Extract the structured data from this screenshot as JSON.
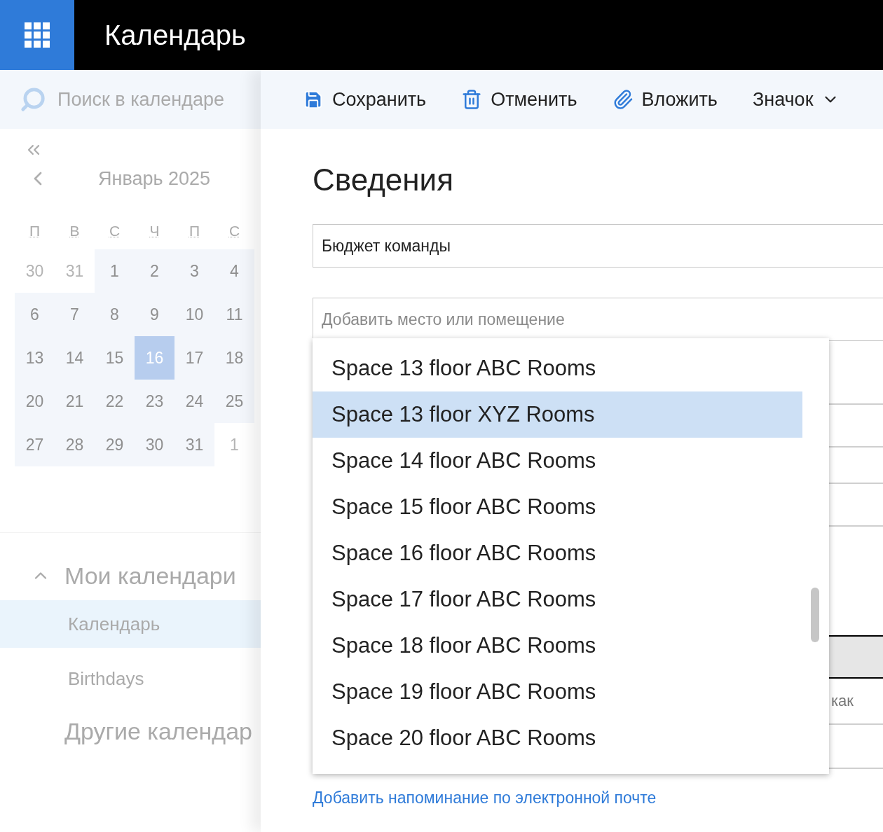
{
  "app_bar": {
    "title": "Календарь"
  },
  "search": {
    "placeholder": "Поиск в календаре"
  },
  "mini_calendar": {
    "month": "Январь 2025",
    "weekdays": [
      "П",
      "В",
      "С",
      "Ч",
      "П",
      "С"
    ],
    "weeks": [
      [
        {
          "label": "30",
          "other_month": true,
          "selected": false
        },
        {
          "label": "31",
          "other_month": true,
          "selected": false
        },
        {
          "label": "1",
          "other_month": false,
          "selected": false
        },
        {
          "label": "2",
          "other_month": false,
          "selected": false
        },
        {
          "label": "3",
          "other_month": false,
          "selected": false
        },
        {
          "label": "4",
          "other_month": false,
          "selected": false
        }
      ],
      [
        {
          "label": "6",
          "other_month": false,
          "selected": false
        },
        {
          "label": "7",
          "other_month": false,
          "selected": false
        },
        {
          "label": "8",
          "other_month": false,
          "selected": false
        },
        {
          "label": "9",
          "other_month": false,
          "selected": false
        },
        {
          "label": "10",
          "other_month": false,
          "selected": false
        },
        {
          "label": "11",
          "other_month": false,
          "selected": false
        }
      ],
      [
        {
          "label": "13",
          "other_month": false,
          "selected": false
        },
        {
          "label": "14",
          "other_month": false,
          "selected": false
        },
        {
          "label": "15",
          "other_month": false,
          "selected": false
        },
        {
          "label": "16",
          "other_month": false,
          "selected": true
        },
        {
          "label": "17",
          "other_month": false,
          "selected": false
        },
        {
          "label": "18",
          "other_month": false,
          "selected": false
        }
      ],
      [
        {
          "label": "20",
          "other_month": false,
          "selected": false
        },
        {
          "label": "21",
          "other_month": false,
          "selected": false
        },
        {
          "label": "22",
          "other_month": false,
          "selected": false
        },
        {
          "label": "23",
          "other_month": false,
          "selected": false
        },
        {
          "label": "24",
          "other_month": false,
          "selected": false
        },
        {
          "label": "25",
          "other_month": false,
          "selected": false
        }
      ],
      [
        {
          "label": "27",
          "other_month": false,
          "selected": false
        },
        {
          "label": "28",
          "other_month": false,
          "selected": false
        },
        {
          "label": "29",
          "other_month": false,
          "selected": false
        },
        {
          "label": "30",
          "other_month": false,
          "selected": false
        },
        {
          "label": "31",
          "other_month": false,
          "selected": false
        },
        {
          "label": "1",
          "other_month": true,
          "selected": false
        }
      ]
    ]
  },
  "my_calendars": {
    "title": "Мои календари",
    "expanded": true,
    "items": [
      {
        "label": "Календарь",
        "selected": true
      },
      {
        "label": "Birthdays",
        "selected": false
      }
    ]
  },
  "other_calendars": {
    "title": "Другие календар"
  },
  "toolbar": [
    {
      "kind": "save",
      "label": "Сохранить"
    },
    {
      "kind": "discard",
      "label": "Отменить"
    },
    {
      "kind": "attach",
      "label": "Вложить"
    },
    {
      "kind": "menu",
      "label": "Значок"
    }
  ],
  "details": {
    "heading": "Сведения",
    "title_value": "Бюджет команды",
    "location_placeholder": "Добавить место или помещение",
    "partial_text": "как",
    "reminder_link": "Добавить напоминание по электронной почте"
  },
  "room_dropdown": [
    {
      "label": "Space 13 floor ABC Rooms",
      "selected": false
    },
    {
      "label": "Space 13 floor XYZ Rooms",
      "selected": true
    },
    {
      "label": "Space 14 floor ABC Rooms",
      "selected": false
    },
    {
      "label": "Space 15 floor ABC Rooms",
      "selected": false
    },
    {
      "label": "Space 16 floor ABC Rooms",
      "selected": false
    },
    {
      "label": "Space 17 floor ABC Rooms",
      "selected": false
    },
    {
      "label": "Space 18 floor ABC Rooms",
      "selected": false
    },
    {
      "label": "Space 19 floor ABC Rooms",
      "selected": false
    },
    {
      "label": "Space 20 floor ABC Rooms",
      "selected": false
    }
  ]
}
